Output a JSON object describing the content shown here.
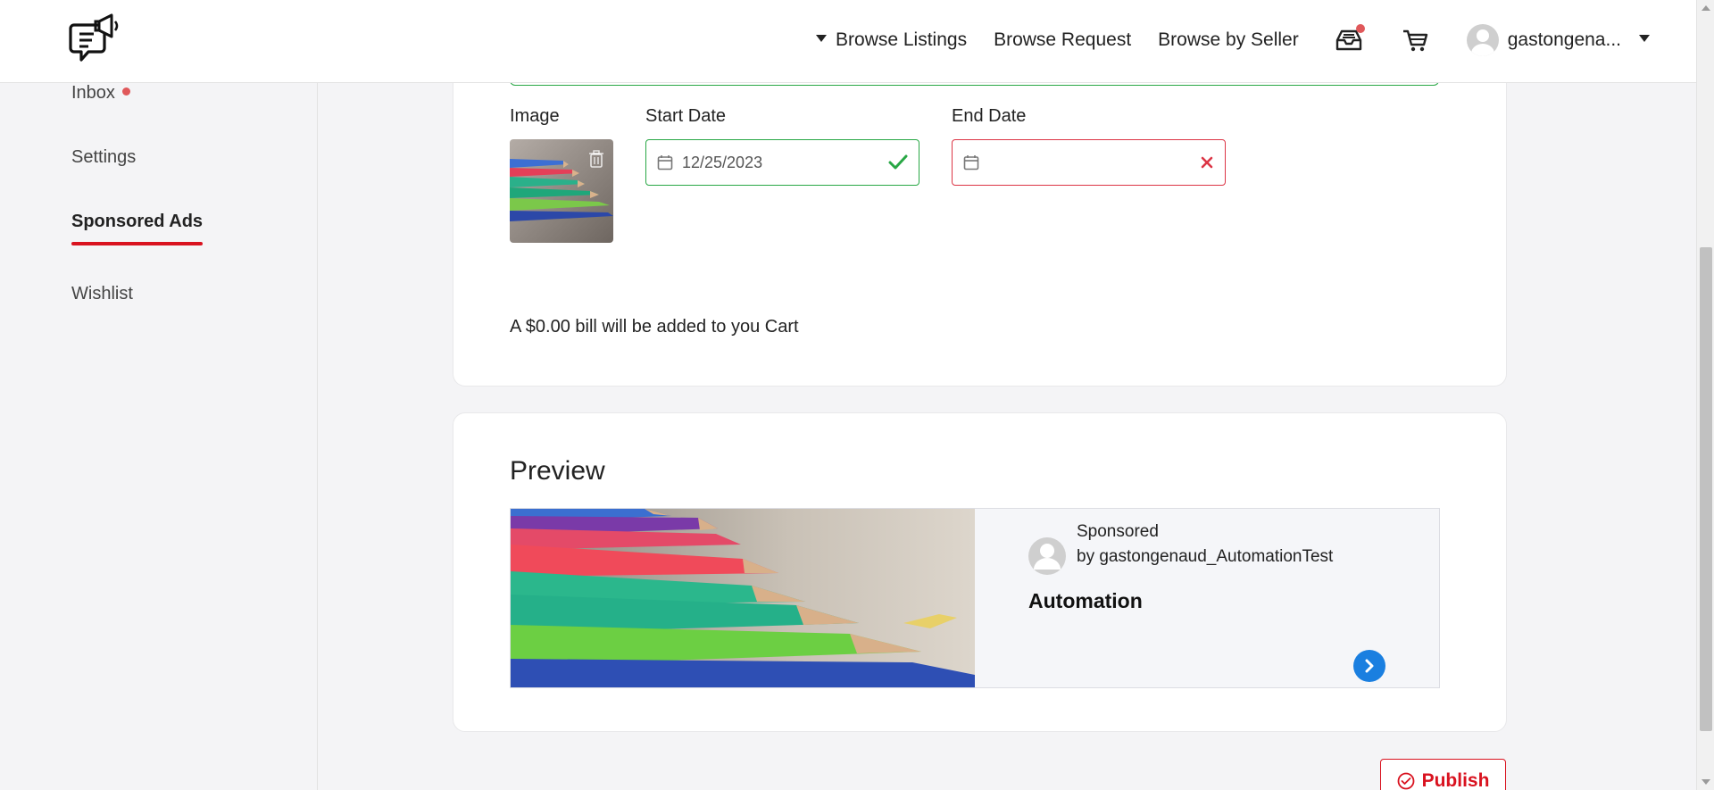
{
  "header": {
    "nav": {
      "browse_listings": "Browse Listings",
      "browse_request": "Browse Request",
      "browse_by_seller": "Browse by Seller"
    },
    "icons": {
      "logo": "megaphone-chat-logo",
      "inbox": "inbox-tray-icon",
      "cart": "cart-icon",
      "caret": "caret-down-icon"
    },
    "user": {
      "name": "gastongena..."
    }
  },
  "sidebar": {
    "items": [
      {
        "label": "Inbox",
        "has_notification": true
      },
      {
        "label": "Settings"
      },
      {
        "label": "Sponsored Ads",
        "active": true
      },
      {
        "label": "Wishlist"
      }
    ]
  },
  "form": {
    "image_label": "Image",
    "start_date_label": "Start Date",
    "start_date_value": "12/25/2023",
    "end_date_label": "End Date",
    "end_date_value": "",
    "bill_text": "A $0.00 bill will be added to you Cart"
  },
  "preview": {
    "title": "Preview",
    "sponsored_label": "Sponsored",
    "by_line": "by gastongenaud_AutomationTest",
    "ad_title": "Automation"
  },
  "actions": {
    "publish_label": "Publish"
  },
  "colors": {
    "accent_red": "#d9121f",
    "valid_green": "#28a745",
    "error_red": "#dc3545",
    "link_blue": "#1a7fe0"
  }
}
